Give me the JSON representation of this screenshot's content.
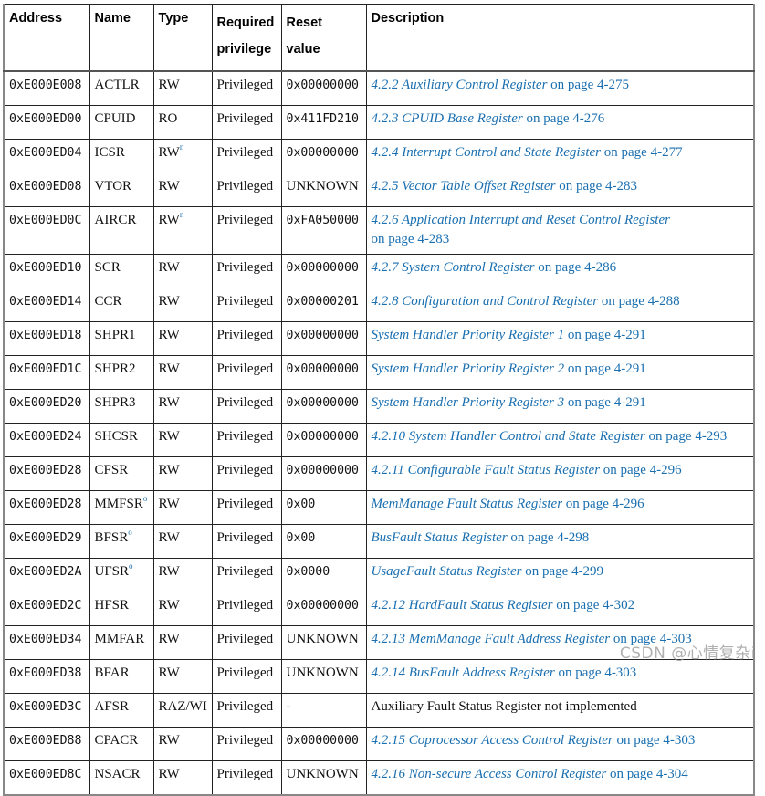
{
  "table": {
    "headers": {
      "address": "Address",
      "name": "Name",
      "type": "Type",
      "privilege_line1": "Required",
      "privilege_line2": "privilege",
      "reset_line1": "Reset",
      "reset_line2": "value",
      "description": "Description"
    },
    "rows": [
      {
        "address": "0xE000E008",
        "name": "ACTLR",
        "name_sup": "",
        "type": "RW",
        "type_sup": "",
        "privilege": "Privileged",
        "reset": "0x00000000",
        "reset_mono": true,
        "desc_title": "4.2.2 Auxiliary Control Register",
        "desc_suffix": " on page 4-275",
        "desc_link": true
      },
      {
        "address": "0xE000ED00",
        "name": "CPUID",
        "name_sup": "",
        "type": "RO",
        "type_sup": "",
        "privilege": "Privileged",
        "reset": "0x411FD210",
        "reset_mono": true,
        "desc_title": "4.2.3 CPUID Base Register",
        "desc_suffix": " on page 4-276",
        "desc_link": true
      },
      {
        "address": "0xE000ED04",
        "name": "ICSR",
        "name_sup": "",
        "type": "RW",
        "type_sup": "n",
        "privilege": "Privileged",
        "reset": "0x00000000",
        "reset_mono": true,
        "desc_title": "4.2.4 Interrupt Control and State Register",
        "desc_suffix": " on page 4-277",
        "desc_link": true
      },
      {
        "address": "0xE000ED08",
        "name": "VTOR",
        "name_sup": "",
        "type": "RW",
        "type_sup": "",
        "privilege": "Privileged",
        "reset": "UNKNOWN",
        "reset_mono": false,
        "desc_title": "4.2.5 Vector Table Offset Register",
        "desc_suffix": " on page 4-283",
        "desc_link": true
      },
      {
        "address": "0xE000ED0C",
        "name": "AIRCR",
        "name_sup": "",
        "type": "RW",
        "type_sup": "n",
        "privilege": "Privileged",
        "reset": "0xFA050000",
        "reset_mono": true,
        "desc_title": "4.2.6 Application Interrupt and Reset Control Register",
        "desc_suffix": "on page 4-283",
        "desc_link": true,
        "desc_wrap": true
      },
      {
        "address": "0xE000ED10",
        "name": "SCR",
        "name_sup": "",
        "type": "RW",
        "type_sup": "",
        "privilege": "Privileged",
        "reset": "0x00000000",
        "reset_mono": true,
        "desc_title": "4.2.7 System Control Register",
        "desc_suffix": " on page 4-286",
        "desc_link": true
      },
      {
        "address": "0xE000ED14",
        "name": "CCR",
        "name_sup": "",
        "type": "RW",
        "type_sup": "",
        "privilege": "Privileged",
        "reset": "0x00000201",
        "reset_mono": true,
        "desc_title": "4.2.8 Configuration and Control Register",
        "desc_suffix": " on page 4-288",
        "desc_link": true
      },
      {
        "address": "0xE000ED18",
        "name": "SHPR1",
        "name_sup": "",
        "type": "RW",
        "type_sup": "",
        "privilege": "Privileged",
        "reset": "0x00000000",
        "reset_mono": true,
        "desc_title": "System Handler Priority Register 1",
        "desc_suffix": " on page 4-291",
        "desc_link": true
      },
      {
        "address": "0xE000ED1C",
        "name": "SHPR2",
        "name_sup": "",
        "type": "RW",
        "type_sup": "",
        "privilege": "Privileged",
        "reset": "0x00000000",
        "reset_mono": true,
        "desc_title": "System Handler Priority Register 2",
        "desc_suffix": " on page 4-291",
        "desc_link": true
      },
      {
        "address": "0xE000ED20",
        "name": "SHPR3",
        "name_sup": "",
        "type": "RW",
        "type_sup": "",
        "privilege": "Privileged",
        "reset": "0x00000000",
        "reset_mono": true,
        "desc_title": "System Handler Priority Register 3",
        "desc_suffix": " on page 4-291",
        "desc_link": true
      },
      {
        "address": "0xE000ED24",
        "name": "SHCSR",
        "name_sup": "",
        "type": "RW",
        "type_sup": "",
        "privilege": "Privileged",
        "reset": "0x00000000",
        "reset_mono": true,
        "desc_title": "4.2.10 System Handler Control and State Register",
        "desc_suffix": " on page 4-293",
        "desc_link": true
      },
      {
        "address": "0xE000ED28",
        "name": "CFSR",
        "name_sup": "",
        "type": "RW",
        "type_sup": "",
        "privilege": "Privileged",
        "reset": "0x00000000",
        "reset_mono": true,
        "desc_title": "4.2.11 Configurable Fault Status Register",
        "desc_suffix": " on page 4-296",
        "desc_link": true
      },
      {
        "address": "0xE000ED28",
        "name": "MMFSR",
        "name_sup": "o",
        "type": "RW",
        "type_sup": "",
        "privilege": "Privileged",
        "reset": "0x00",
        "reset_mono": true,
        "desc_title": "MemManage Fault Status Register",
        "desc_suffix": " on page 4-296",
        "desc_link": true
      },
      {
        "address": "0xE000ED29",
        "name": "BFSR",
        "name_sup": "o",
        "type": "RW",
        "type_sup": "",
        "privilege": "Privileged",
        "reset": "0x00",
        "reset_mono": true,
        "desc_title": "BusFault Status Register",
        "desc_suffix": " on page 4-298",
        "desc_link": true
      },
      {
        "address": "0xE000ED2A",
        "name": "UFSR",
        "name_sup": "o",
        "type": "RW",
        "type_sup": "",
        "privilege": "Privileged",
        "reset": "0x0000",
        "reset_mono": true,
        "desc_title": "UsageFault Status Register",
        "desc_suffix": " on page 4-299",
        "desc_link": true
      },
      {
        "address": "0xE000ED2C",
        "name": "HFSR",
        "name_sup": "",
        "type": "RW",
        "type_sup": "",
        "privilege": "Privileged",
        "reset": "0x00000000",
        "reset_mono": true,
        "desc_title": "4.2.12 HardFault Status Register",
        "desc_suffix": " on page 4-302",
        "desc_link": true
      },
      {
        "address": "0xE000ED34",
        "name": "MMFAR",
        "name_sup": "",
        "type": "RW",
        "type_sup": "",
        "privilege": "Privileged",
        "reset": "UNKNOWN",
        "reset_mono": false,
        "desc_title": "4.2.13 MemManage Fault Address Register",
        "desc_suffix": " on page 4-303",
        "desc_link": true
      },
      {
        "address": "0xE000ED38",
        "name": "BFAR",
        "name_sup": "",
        "type": "RW",
        "type_sup": "",
        "privilege": "Privileged",
        "reset": "UNKNOWN",
        "reset_mono": false,
        "desc_title": "4.2.14 BusFault Address Register",
        "desc_suffix": " on page 4-303",
        "desc_link": true
      },
      {
        "address": "0xE000ED3C",
        "name": "AFSR",
        "name_sup": "",
        "type": "RAZ/WI",
        "type_sup": "",
        "privilege": "Privileged",
        "reset": "-",
        "reset_mono": false,
        "desc_title": "",
        "desc_suffix": "Auxiliary Fault Status Register not implemented",
        "desc_link": false
      },
      {
        "address": "0xE000ED88",
        "name": "CPACR",
        "name_sup": "",
        "type": "RW",
        "type_sup": "",
        "privilege": "Privileged",
        "reset": "0x00000000",
        "reset_mono": true,
        "desc_title": "4.2.15 Coprocessor Access Control Register",
        "desc_suffix": " on page 4-303",
        "desc_link": true
      },
      {
        "address": "0xE000ED8C",
        "name": "NSACR",
        "name_sup": "",
        "type": "RW",
        "type_sup": "",
        "privilege": "Privileged",
        "reset": "UNKNOWN",
        "reset_mono": false,
        "desc_title": "4.2.16 Non-secure Access Control Register",
        "desc_suffix": " on page 4-304",
        "desc_link": true
      }
    ]
  },
  "colors": {
    "link": "#1a6fb0",
    "text": "#111111",
    "border": "#222222"
  },
  "watermark": "CSDN @心情复杂i"
}
